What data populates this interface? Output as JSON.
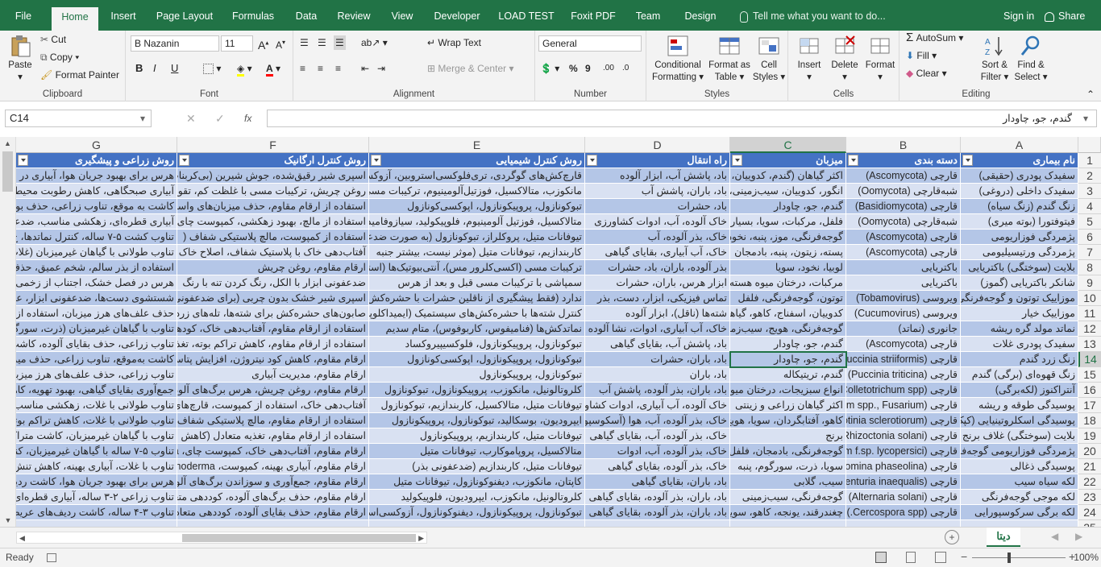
{
  "tabs": [
    "File",
    "Home",
    "Insert",
    "Page Layout",
    "Formulas",
    "Data",
    "Review",
    "View",
    "Developer",
    "LOAD TEST",
    "Foxit PDF",
    "Team",
    "Design"
  ],
  "tell_me": "Tell me what you want to do...",
  "sign_in": "Sign in",
  "share": "Share",
  "clipboard": {
    "paste": "Paste",
    "cut": "Cut",
    "copy": "Copy",
    "format_painter": "Format Painter",
    "label": "Clipboard"
  },
  "font": {
    "name": "B Nazanin",
    "size": "11",
    "label": "Font"
  },
  "alignment": {
    "wrap": "Wrap Text",
    "merge": "Merge & Center",
    "label": "Alignment"
  },
  "number": {
    "format": "General",
    "label": "Number"
  },
  "styles": {
    "conditional": "Conditional",
    "formatting": "Formatting",
    "format_as": "Format as",
    "table": "Table",
    "cell": "Cell",
    "cell_styles": "Styles",
    "label": "Styles"
  },
  "cells": {
    "insert": "Insert",
    "delete": "Delete",
    "format": "Format",
    "label": "Cells"
  },
  "editing": {
    "autosum": "AutoSum",
    "fill": "Fill",
    "clear": "Clear",
    "sort": "Sort &",
    "filter": "Filter",
    "find": "Find &",
    "select": "Select",
    "label": "Editing"
  },
  "name_box": "C14",
  "formula": "گندم، جو، چاودار",
  "columns": [
    "A",
    "B",
    "C",
    "D",
    "E",
    "F",
    "G"
  ],
  "header_row": [
    "نام بیماری",
    "دسته بندی",
    "میزبان",
    "راه انتقال",
    "روش کنترل شیمیایی",
    "روش کنترل ارگانیک",
    "روش زراعی و پیشگیری"
  ],
  "rows": [
    [
      "سفیدک پودری (حقیقی)",
      "قارچی (Ascomycota)",
      "اکثر گیاهان (گندم، کدوییان، جو",
      "باد، پاشش آب، ابزار آلوده",
      "قارچ‌کش‌های گوگردی، تری‌فلوکسی‌استروبین، آزوکسی",
      "اسپری شیر رقیق‌شده، جوش شیرین (بی‌کربنات",
      "هرس برای بهبود جریان هوا، آبیاری در"
    ],
    [
      "سفیدک داخلی (دروغی)",
      "شبه‌قارچی (Oomycota)",
      "انگور، کدوییان، سیب‌زمینی، باد",
      "باد، باران، پاشش آب",
      "مانکوزب، متالاکسیل، فوزتیل‌آلومینیوم، ترکیبات مسی",
      "روغن چریش، ترکیبات مسی با غلظت کم، تقویت",
      "آبیاری صبحگاهی، کاهش رطوبت محیط"
    ],
    [
      "زنگ گندم (زنگ سیاه)",
      "قارچی (Basidiomycota)",
      "گندم، جو، چاودار",
      "باد، حشرات",
      "تبوکونازول، پروپیکونازول، اپوکسی‌کونازول",
      "استفاده از ارقام مقاوم، حذف میزبان‌های واسط (",
      "کاشت به موقع، تناوب زراعی، حذف بوته"
    ],
    [
      "فیتوفتورا (بوته میری)",
      "شبه‌قارچی (Oomycota)",
      "فلفل، مرکبات، سویا، بسیاری آب",
      "خاک آلوده، آب، ادوات کشاورزی",
      "متالاکسیل، فوزتیل آلومینیوم، فلوپیکولید، سیازوفامید",
      "استفاده از مالچ، بهبود زهکشی، کمپوست چای",
      "آبیاری قطره‌ای، زهکشی مناسب، ضدعفونی"
    ],
    [
      "پژمردگی فوزاریومی",
      "قارچی (Ascomycota)",
      "گوجه‌فرنگی، موز، پنبه، نخود",
      "خاک، بذر آلوده، آب",
      "تیوفانات متیل، پروکلراز، تبوکونازول (به صورت ضدعفونی",
      "استفاده از کمپوست، مالچ پلاستیکی شفاف (",
      "تناوب کشت ۵-۷ ساله، کنترل نماتدها، ج"
    ],
    [
      "پژمردگی ورتیسیلیومی",
      "قارچی (Ascomycota)",
      "پسته، زیتون، پنبه، بادمجان",
      "خاک، آب آبیاری، بقایای گیاهی",
      "کاربندازیم، تیوفانات متیل (موثر نیست، بیشتر جنبه",
      "آفتاب‌دهی خاک با پلاستیک شفاف، اصلاح خاک",
      "تناوب طولانی با گیاهان غیرمیزبان (غلات"
    ],
    [
      "بلایت (سوختگی) باکتریایی",
      "باکتریایی",
      "لوبیا، نخود، سویا",
      "بذر آلوده، باران، باد، حشرات",
      "ترکیبات مسی (اکسی‌کلرور مس)، آنتی‌بیوتیک‌ها (استر",
      "ارقام مقاوم، روغن چریش",
      "استفاده از بذر سالم، شخم عمیق، حذف بقایا"
    ],
    [
      "شانکر باکتریایی (گموز)",
      "باکتریایی",
      "مرکبات، درختان میوه هسته‌دار",
      "ابزار هرس، باران، حشرات",
      "سمپاشی با ترکیبات مسی قبل و بعد از هرس",
      "ضدعفونی ابزار با الکل، رنگ کردن تنه با رنگ",
      "هرس در فصل خشک، اجتناب از زخمی کردن"
    ],
    [
      "موزاییک توتون و گوجه‌فرنگی",
      "ویروسی (Tobamovirus)",
      "توتون، گوجه‌فرنگی، فلفل",
      "تماس فیزیکی، ابزار، دست، بذر",
      "ندارد (فقط پیشگیری از ناقلین حشرات با حشره‌کش)",
      "اسپری شیر خشک بدون چربی (برای ضدعفونی",
      "شستشوی دست‌ها، ضدعفونی ابزار، عدم"
    ],
    [
      "موزاییک خیار",
      "ویروسی (Cucumovirus)",
      "کدوییان، اسفناج، کاهو، گیاهان",
      "شته‌ها (ناقل)، ابزار آلوده",
      "کنترل شته‌ها با حشره‌کش‌های سیستمیک (ایمیداکلوپرید",
      "صابون‌های حشره‌کش برای شته‌ها، تله‌های زرد",
      "حذف علف‌های هرز میزبان، استفاده از ارقام"
    ],
    [
      "نماتد مولد گره ریشه",
      "جانوری (نماتد)",
      "گوجه‌فرنگی، هویج، سیب‌زمینی",
      "خاک، آب آبیاری، ادوات، نشا آلوده",
      "نماتدکش‌ها (فنامیفوس، کاربوفوس)، متام سدیم",
      "استفاده از ارقام مقاوم، آفتاب‌دهی خاک، کودهای",
      "تناوب با گیاهان غیرمیزبان (ذرت، سورگوم)"
    ],
    [
      "سفیدک پودری غلات",
      "قارچی (Ascomycota)",
      "گندم، جو، چاودار",
      "باد، پاشش آب، بقایای گیاهی",
      "تبوکونازول، پروپیکونازول، فلوکسیپیروکساد",
      "استفاده از ارقام مقاوم، کاهش تراکم بوته، تغذیه",
      "تناوب زراعی، حذف بقایای آلوده، کاشت"
    ],
    [
      "زنگ زرد گندم",
      "قارچی (Puccinia striiformis)",
      "گندم، جو، چاودار",
      "باد، باران، حشرات",
      "تبوکونازول، پروپیکونازول، اپوکسی‌کونازول",
      "ارقام مقاوم، کاهش کود نیتروژن، افزایش پتاسیم",
      "کاشت به‌موقع، تناوب زراعی، حذف میزبان"
    ],
    [
      "زنگ قهوه‌ای (برگی) گندم",
      "قارچی (Puccinia triticina)",
      "گندم، تریتیکاله",
      "باد، باران",
      "تبوکونازول، پروپیکونازول",
      "ارقام مقاوم، مدیریت آبیاری",
      "تناوب زراعی، حذف علف‌های هرز میزبان"
    ],
    [
      "آنتراکنوز (لکه‌برگی)",
      "قارچی (Colletotrichum spp.)",
      "انواع سبزیجات، درختان میوه",
      "باد، باران، بذر آلوده، پاشش آب",
      "کلروتالونیل، مانکوزب، پروپیکونازول، تبوکونازول",
      "ارقام مقاوم، روغن چریش، هرس برگ‌های آلوده",
      "جمع‌آوری بقایای گیاهی، بهبود تهویه، کاهش"
    ],
    [
      "پوسیدگی طوقه و ریشه",
      "قارچی (Pythium spp., Fusarium)",
      "اکثر گیاهان زراعی و زینتی",
      "خاک آلوده، آب آبیاری، ادوات کشاورزی",
      "تیوفانات متیل، متالاکسیل، کاربندازیم، تبوکونازول",
      "آفتاب‌دهی خاک، استفاده از کمپوست، قارچ‌های آنتاگونیست",
      "تناوب طولانی با غلات، زهکشی مناسب، اجتناب"
    ],
    [
      "پوسیدگی اسکلروتینیایی (کپک سفید)",
      "قارچی (Sclerotinia sclerotiorum)",
      "کاهو، آفتابگردان، سویا، هویج",
      "خاک، بذر آلوده، آب، هوا (آسکوسپور)",
      "ایپرودیون، بوسکالید، تبوکونازول، پروپیکونازول",
      "استفاده از ارقام مقاوم، مالچ پلاستیکی شفاف (آفتاب‌دهی)",
      "تناوب طولانی با غلات، کاهش تراکم بوته، اجتناب"
    ],
    [
      "بلایت (سوختگی) غلاف برنج",
      "قارچی (Rhizoctonia solani)",
      "برنج",
      "خاک، بذر آلوده، آب، بقایای گیاهی",
      "تیوفانات متیل، کاربندازیم، پروپیکونازول",
      "استفاده از ارقام مقاوم، تغذیه متعادل (کاهش نیتروژن)",
      "تناوب با گیاهان غیرمیزبان، کاشت متراکم، زهکشی"
    ],
    [
      "پژمردگی فوزاریومی گوجه‌فرنگی",
      "قارچی (Fusarium oxysporum f.sp. lycopersici)",
      "گوجه‌فرنگی، بادمجان، فلفل",
      "خاک، بذر آلوده، آب، ادوات",
      "متالاکسیل، پروپاموکارب، تیوفانات متیل",
      "ارقام مقاوم، آفتاب‌دهی خاک، کمپوست چای، Trichoderma",
      "تناوب ۵-۷ ساله با گیاهان غیرمیزبان، کنترل نماتدها"
    ],
    [
      "پوسیدگی ذغالی",
      "قارچی (Macrophomina phaseolina)",
      "سویا، ذرت، سورگوم، پنبه",
      "خاک، بذر آلوده، بقایای گیاهی",
      "تیوفانات متیل، کاربندازیم (ضدعفونی بذر)",
      "ارقام مقاوم، آبیاری بهینه، کمپوست، Trichoderma",
      "تناوب با غلات، آبیاری بهینه، کاهش تنش خشکی"
    ],
    [
      "لکه سیاه سیب",
      "قارچی (Venturia inaequalis)",
      "سیب، گلابی",
      "باد، باران، بقایای گیاهی",
      "کاپتان، مانکوزب، دیفنوکونازول، تیوفانات متیل",
      "ارقام مقاوم، جمع‌آوری و سوزاندن برگ‌های آلوده",
      "هرس برای بهبود جریان هوا، کاشت ردیفی"
    ],
    [
      "لکه موجی گوجه‌فرنگی",
      "قارچی (Alternaria solani)",
      "گوجه‌فرنگی، سیب‌زمینی",
      "باد، باران، بذر آلوده، بقایای گیاهی",
      "کلروتالونیل، مانکوزب، ایپرودیون، فلوپیکولید",
      "ارقام مقاوم، حذف برگ‌های آلوده، کوددهی متعادل",
      "تناوب زراعی ۲-۳ ساله، آبیاری قطره‌ای"
    ],
    [
      "لکه برگی سرکوسپورایی",
      "قارچی (Cercospora spp.)",
      "چغندرقند، یونجه، کاهو، سویا",
      "باد، باران، بذر آلوده، بقایای گیاهی",
      "تبوکونازول، پروپیکونازول، دیفنوکونازول، آزوکسی‌استروبین",
      "ارقام مقاوم، حذف بقایای آلوده، کوددهی متعادل",
      "تناوب ۳-۴ ساله، کاشت ردیف‌های عریض"
    ],
    [
      "",
      "",
      "",
      "",
      "",
      "",
      ""
    ]
  ],
  "row_numbers": [
    "1",
    "2",
    "3",
    "4",
    "5",
    "6",
    "7",
    "8",
    "9",
    "10",
    "11",
    "12",
    "13",
    "14",
    "15",
    "16",
    "17",
    "18",
    "19",
    "20",
    "21",
    "22",
    "23",
    "24",
    "25"
  ],
  "sheet_tab": "دیتا",
  "status_ready": "Ready",
  "zoom": "100%",
  "colors": {
    "excel_green": "#217346",
    "table_header": "#4472c4",
    "band_dark": "#b4c6e7",
    "band_light": "#d9e1f2"
  }
}
